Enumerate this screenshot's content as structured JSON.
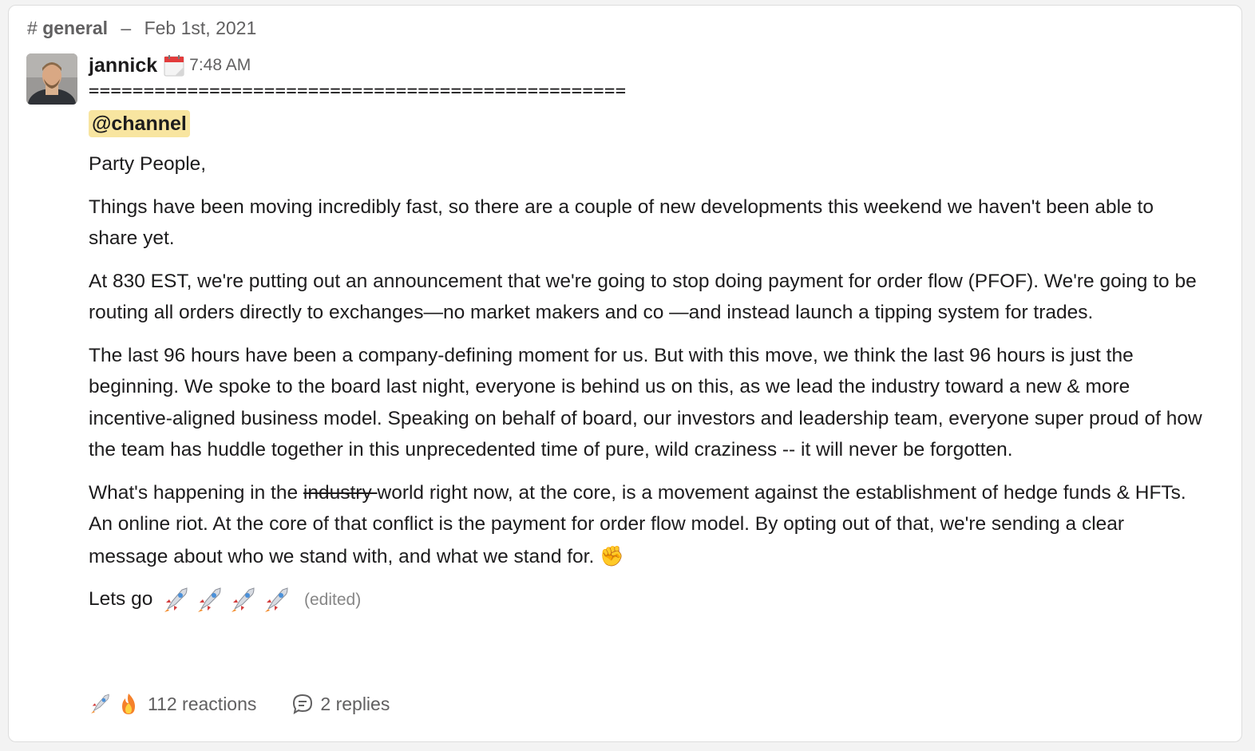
{
  "channel": {
    "hash": "#",
    "name": "general",
    "separator": "–",
    "date": "Feb 1st, 2021"
  },
  "message": {
    "author": "jannick",
    "time": "7:48 AM",
    "rule": "=================================================",
    "mention": "@channel",
    "greeting": "Party People,",
    "para1": "Things have been moving incredibly fast, so there are a couple of new developments this weekend we haven't been able to share yet.",
    "para2": "At 830 EST, we're putting out an announcement that we're going to stop doing payment for order flow (PFOF). We're going to be routing all orders directly to exchanges—no market makers and co —and instead launch a tipping system for trades.",
    "para3": "The last 96 hours have been a company-defining moment for us. But with this move, we think the last 96 hours is just the beginning. We spoke to the board last night, everyone is behind us on this, as we lead the industry toward a new & more incentive-aligned business model. Speaking on behalf of board, our investors and leadership team, everyone super proud of how the team has huddle together in this unprecedented time of pure, wild craziness -- it will never be forgotten.",
    "para4_before": "What's happening in the ",
    "para4_strike": "industry ",
    "para4_after": "world right now, at the core, is a movement against the establishment of hedge funds & HFTs.  An online riot.  At the core of that conflict is the payment for order flow model. By opting out of that, we're sending a clear message about who we stand with, and what we stand for.",
    "fist_emoji": "✊",
    "closing": "Lets go",
    "edited": "(edited)"
  },
  "footer": {
    "reactions_label": "112 reactions",
    "replies_label": "2 replies"
  },
  "colors": {
    "mention_bg": "#f8e5a0",
    "muted": "#616061",
    "text": "#1d1c1d"
  }
}
